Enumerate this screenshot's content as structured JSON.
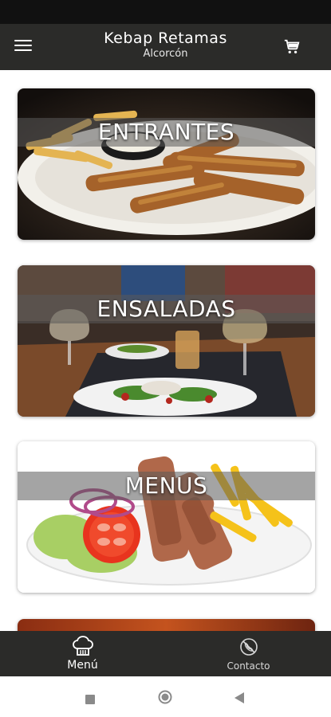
{
  "header": {
    "title": "Kebap Retamas",
    "subtitle": "Alcorcón",
    "menu_icon": "hamburger-menu-icon",
    "cart_icon": "shopping-cart-icon"
  },
  "categories": [
    {
      "label": "ENTRANTES",
      "image": "fried-chicken-strips-with-fries"
    },
    {
      "label": "ENSALADAS",
      "image": "salad-plates-on-restaurant-table"
    },
    {
      "label": "MENUS",
      "image": "kebab-plate-with-salad-and-fries"
    }
  ],
  "bottom_nav": {
    "items": [
      {
        "label": "Menú",
        "icon": "chef-hat-icon",
        "active": true
      },
      {
        "label": "Contacto",
        "icon": "no-phone-icon",
        "active": false
      }
    ]
  },
  "system_nav": {
    "recents_icon": "square-recents-icon",
    "home_icon": "circle-home-icon",
    "back_icon": "triangle-back-icon"
  },
  "colors": {
    "app_bar": "#2b2b29",
    "status_bar": "#111111",
    "text_on_dark": "#ffffff"
  }
}
